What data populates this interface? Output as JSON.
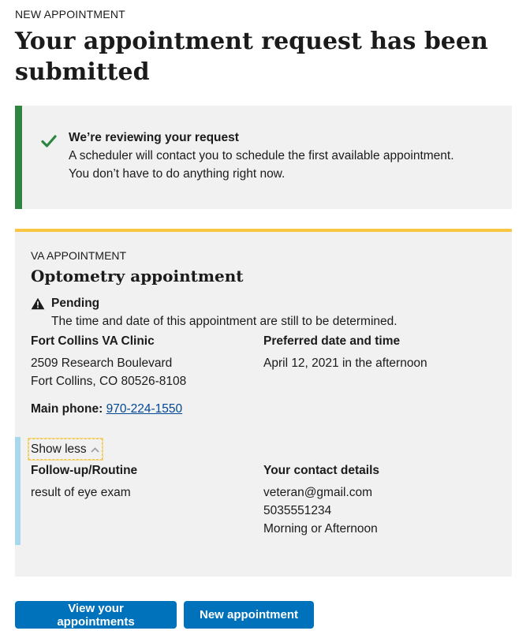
{
  "header": {
    "eyebrow": "New Appointment",
    "title": "Your appointment request has been submitted"
  },
  "alert": {
    "heading": "We’re reviewing your request",
    "lines": [
      "A scheduler will contact you to schedule the first available appointment.",
      "You don’t have to do anything right now."
    ],
    "icon": "check-icon",
    "accent_color": "#2e8540"
  },
  "card": {
    "eyebrow": "VA Appointment",
    "title": "Optometry appointment",
    "status": {
      "icon": "warning-icon",
      "label": "Pending",
      "description": "The time and date of this appointment are still to be determined."
    },
    "facility": {
      "name": "Fort Collins VA Clinic",
      "address_line1": "2509 Research Boulevard",
      "address_line2": "Fort Collins, CO 80526-8108",
      "phone_label": "Main phone:",
      "phone": "970-224-1550"
    },
    "preferred": {
      "heading": "Preferred date and time",
      "value": "April 12, 2021 in the afternoon"
    },
    "toggle_label": "Show less",
    "reason": {
      "heading": "Follow-up/Routine",
      "value": "result of eye exam"
    },
    "contact": {
      "heading": "Your contact details",
      "email": "veteran@gmail.com",
      "phone": "5035551234",
      "time": "Morning or Afternoon"
    },
    "accent_color": "#f9c642"
  },
  "actions": {
    "view_label": "View your appointments",
    "new_label": "New appointment"
  }
}
